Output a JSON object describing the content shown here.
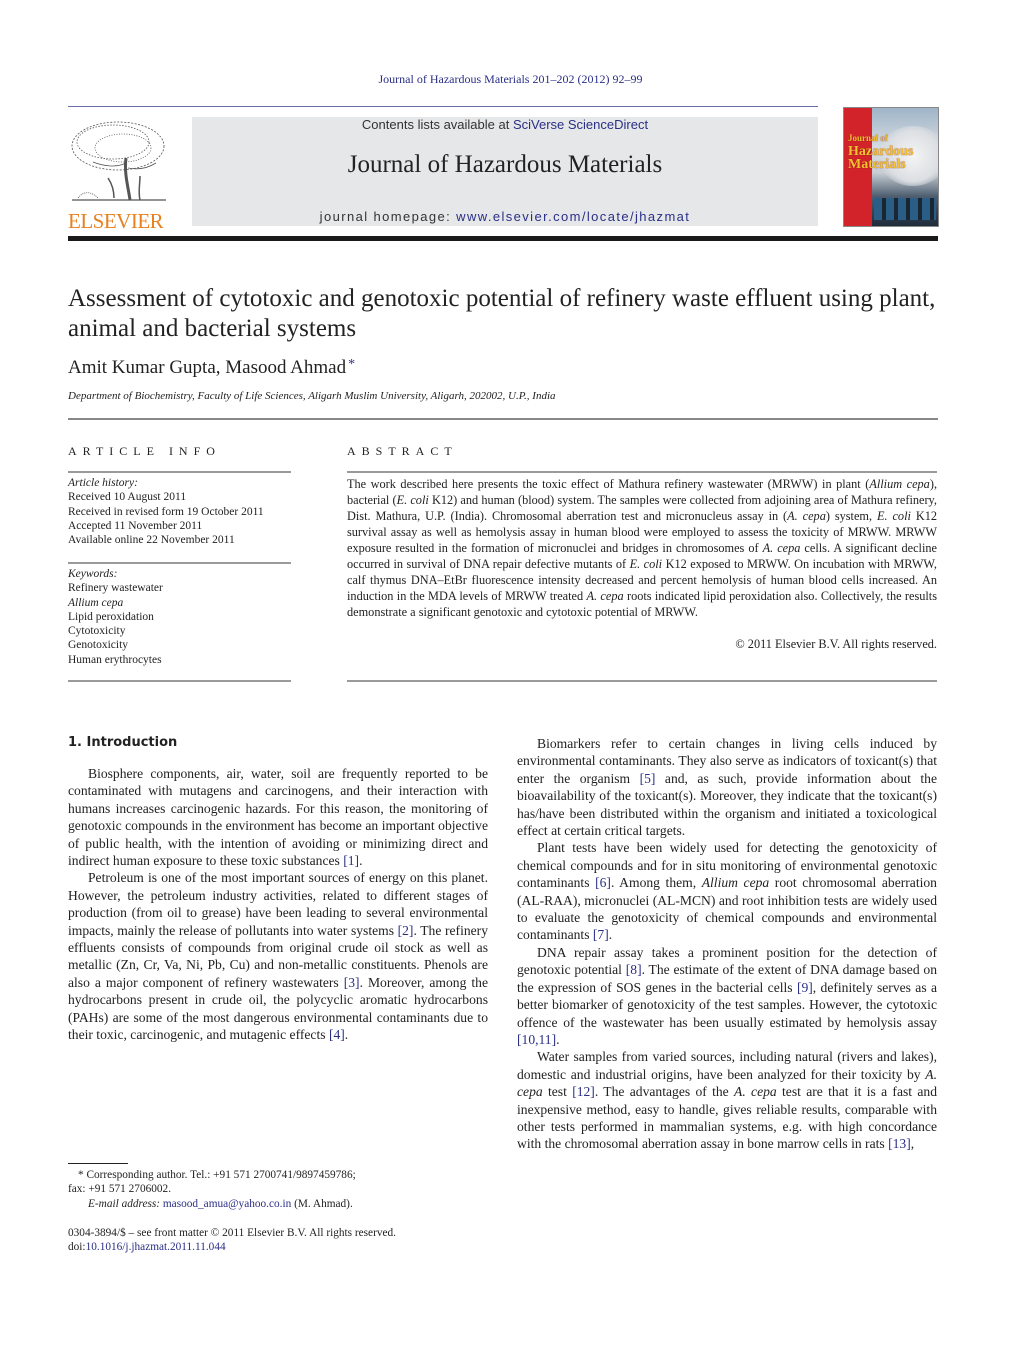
{
  "running_header": "Journal of Hazardous Materials 201–202 (2012) 92–99",
  "publisher": {
    "logo_icon": "elsevier-tree-icon",
    "wordmark": "ELSEVIER"
  },
  "header_band": {
    "contents_prefix": "Contents lists available at ",
    "contents_link": "SciVerse ScienceDirect",
    "journal_name": "Journal of Hazardous Materials",
    "homepage_prefix": "journal homepage: ",
    "homepage_link": "www.elsevier.com/locate/jhazmat"
  },
  "cover": {
    "title_line1": "Journal of",
    "title_line2": "Hazardous",
    "title_line3": "Materials"
  },
  "colors": {
    "link": "#2a2f86",
    "elsevier_orange": "#e8801e",
    "band_grey": "#e6e7e8",
    "cover_red": "#d2232a"
  },
  "article": {
    "title": "Assessment of cytotoxic and genotoxic potential of refinery waste effluent using plant, animal and bacterial systems",
    "authors": "Amit Kumar Gupta, Masood Ahmad",
    "author_mark": "*",
    "affiliation": "Department of Biochemistry, Faculty of Life Sciences, Aligarh Muslim University, Aligarh, 202002, U.P., India"
  },
  "article_info": {
    "heading": "ARTICLE INFO",
    "history_label": "Article history:",
    "history": [
      "Received 10 August 2011",
      "Received in revised form 19 October 2011",
      "Accepted 11 November 2011",
      "Available online 22 November 2011"
    ],
    "keywords_label": "Keywords:",
    "keywords": [
      "Refinery wastewater",
      "Allium cepa",
      "Lipid peroxidation",
      "Cytotoxicity",
      "Genotoxicity",
      "Human erythrocytes"
    ]
  },
  "abstract": {
    "heading": "ABSTRACT",
    "segments": [
      {
        "t": "The work described here presents the toxic effect of Mathura refinery wastewater (MRWW) in plant ("
      },
      {
        "t": "Allium cepa",
        "i": true
      },
      {
        "t": "), bacterial ("
      },
      {
        "t": "E. coli",
        "i": true
      },
      {
        "t": " K12) and human (blood) system. The samples were collected from adjoining area of Mathura refinery, Dist. Mathura, U.P. (India). Chromosomal aberration test and micronucleus assay in ("
      },
      {
        "t": "A. cepa",
        "i": true
      },
      {
        "t": ") system, "
      },
      {
        "t": "E. coli",
        "i": true
      },
      {
        "t": " K12 survival assay as well as hemolysis assay in human blood were employed to assess the toxicity of MRWW. MRWW exposure resulted in the formation of micronuclei and bridges in chromosomes of "
      },
      {
        "t": "A. cepa",
        "i": true
      },
      {
        "t": " cells. A significant decline occurred in survival of DNA repair defective mutants of "
      },
      {
        "t": "E. coli",
        "i": true
      },
      {
        "t": " K12 exposed to MRWW. On incubation with MRWW, calf thymus DNA–EtBr fluorescence intensity decreased and percent hemolysis of human blood cells increased. An induction in the MDA levels of MRWW treated "
      },
      {
        "t": "A. cepa",
        "i": true
      },
      {
        "t": " roots indicated lipid peroxidation also. Collectively, the results demonstrate a significant genotoxic and cytotoxic potential of MRWW."
      }
    ],
    "copyright": "© 2011 Elsevier B.V. All rights reserved."
  },
  "body": {
    "section_heading": "1.  Introduction",
    "left_paragraphs": [
      [
        {
          "t": "Biosphere components, air, water, soil are frequently reported to be contaminated with mutagens and carcinogens, and their interac­tion with humans increases carcinogenic hazards. For this reason, the monitoring of genotoxic compounds in the environment has become an important objective of public health, with the intention of avoiding or minimizing direct and indirect human exposure to these toxic substances "
        },
        {
          "t": "[1]",
          "ref": true
        },
        {
          "t": "."
        }
      ],
      [
        {
          "t": "Petroleum is one of the most important sources of energy on this planet. However, the petroleum industry activities, related to different stages of production (from oil to grease) have been leading to several environmental impacts, mainly the release of pollutants into water systems "
        },
        {
          "t": "[2]",
          "ref": true
        },
        {
          "t": ". The refinery effluents consists of compounds from original crude oil stock as well as metallic (Zn, Cr, Va, Ni, Pb, Cu) and non-metallic constituents. Phenols are also a major component of refinery wastewaters "
        },
        {
          "t": "[3]",
          "ref": true
        },
        {
          "t": ". Moreover, among the hydrocarbons present in crude oil, the polycyclic aromatic hydrocarbons (PAHs) are some of the most dangerous environmen­tal contaminants due to their toxic, carcinogenic, and mutagenic effects "
        },
        {
          "t": "[4]",
          "ref": true
        },
        {
          "t": "."
        }
      ]
    ],
    "right_paragraphs": [
      [
        {
          "t": "Biomarkers refer to certain changes in living cells induced by environmental contaminants. They also serve as indicators of toxicant(s) that enter the organism "
        },
        {
          "t": "[5]",
          "ref": true
        },
        {
          "t": " and, as such, provide infor­mation about the bioavailability of the toxicant(s). Moreover, they indicate that the toxicant(s) has/have been distributed within the organism and initiated a toxicological effect at certain critical tar­gets."
        }
      ],
      [
        {
          "t": "Plant tests have been widely used for detecting the genotoxicity of chemical compounds and for in situ monitoring of environ­mental genotoxic contaminants "
        },
        {
          "t": "[6]",
          "ref": true
        },
        {
          "t": ". Among them, "
        },
        {
          "t": "Allium cepa",
          "i": true
        },
        {
          "t": " root chromosomal aberration (AL-RAA), micronuclei (AL-MCN) and root inhibition tests are widely used to evaluate the genotox­icity of chemical compounds and environmental contaminants "
        },
        {
          "t": "[7]",
          "ref": true
        },
        {
          "t": "."
        }
      ],
      [
        {
          "t": "DNA repair assay takes a prominent position for the detection of genotoxic potential "
        },
        {
          "t": "[8]",
          "ref": true
        },
        {
          "t": ". The estimate of the extent of DNA dam­age based on the expression of SOS genes in the bacterial cells "
        },
        {
          "t": "[9]",
          "ref": true
        },
        {
          "t": ", definitely serves as a better biomarker of genotoxicity of the test samples. However, the cytotoxic offence of the wastewater has been usually estimated by hemolysis assay "
        },
        {
          "t": "[10,11]",
          "ref": true
        },
        {
          "t": "."
        }
      ],
      [
        {
          "t": "Water samples from varied sources, including natural (rivers and lakes), domestic and industrial origins, have been analyzed for their toxicity by "
        },
        {
          "t": "A. cepa",
          "i": true
        },
        {
          "t": " test "
        },
        {
          "t": "[12]",
          "ref": true
        },
        {
          "t": ". The advantages of the "
        },
        {
          "t": "A. cepa",
          "i": true
        },
        {
          "t": " test are that it is a fast and inexpensive method, easy to handle, gives reliable results, comparable with other tests performed in mammalian systems, e.g. with high concordance with the chromosomal aberration assay in bone marrow cells in rats "
        },
        {
          "t": "[13]",
          "ref": true
        },
        {
          "t": ","
        }
      ]
    ]
  },
  "footnotes": {
    "corresponding": "*  Corresponding author. Tel.: +91 571 2700741/9897459786;",
    "fax": "fax: +91 571 2706002.",
    "email_label": "E-mail address:",
    "email": "masood_amua@yahoo.co.in",
    "email_suffix": " (M. Ahmad).",
    "front_matter": "0304-3894/$ – see front matter © 2011 Elsevier B.V. All rights reserved.",
    "doi_prefix": "doi:",
    "doi": "10.1016/j.jhazmat.2011.11.044"
  }
}
